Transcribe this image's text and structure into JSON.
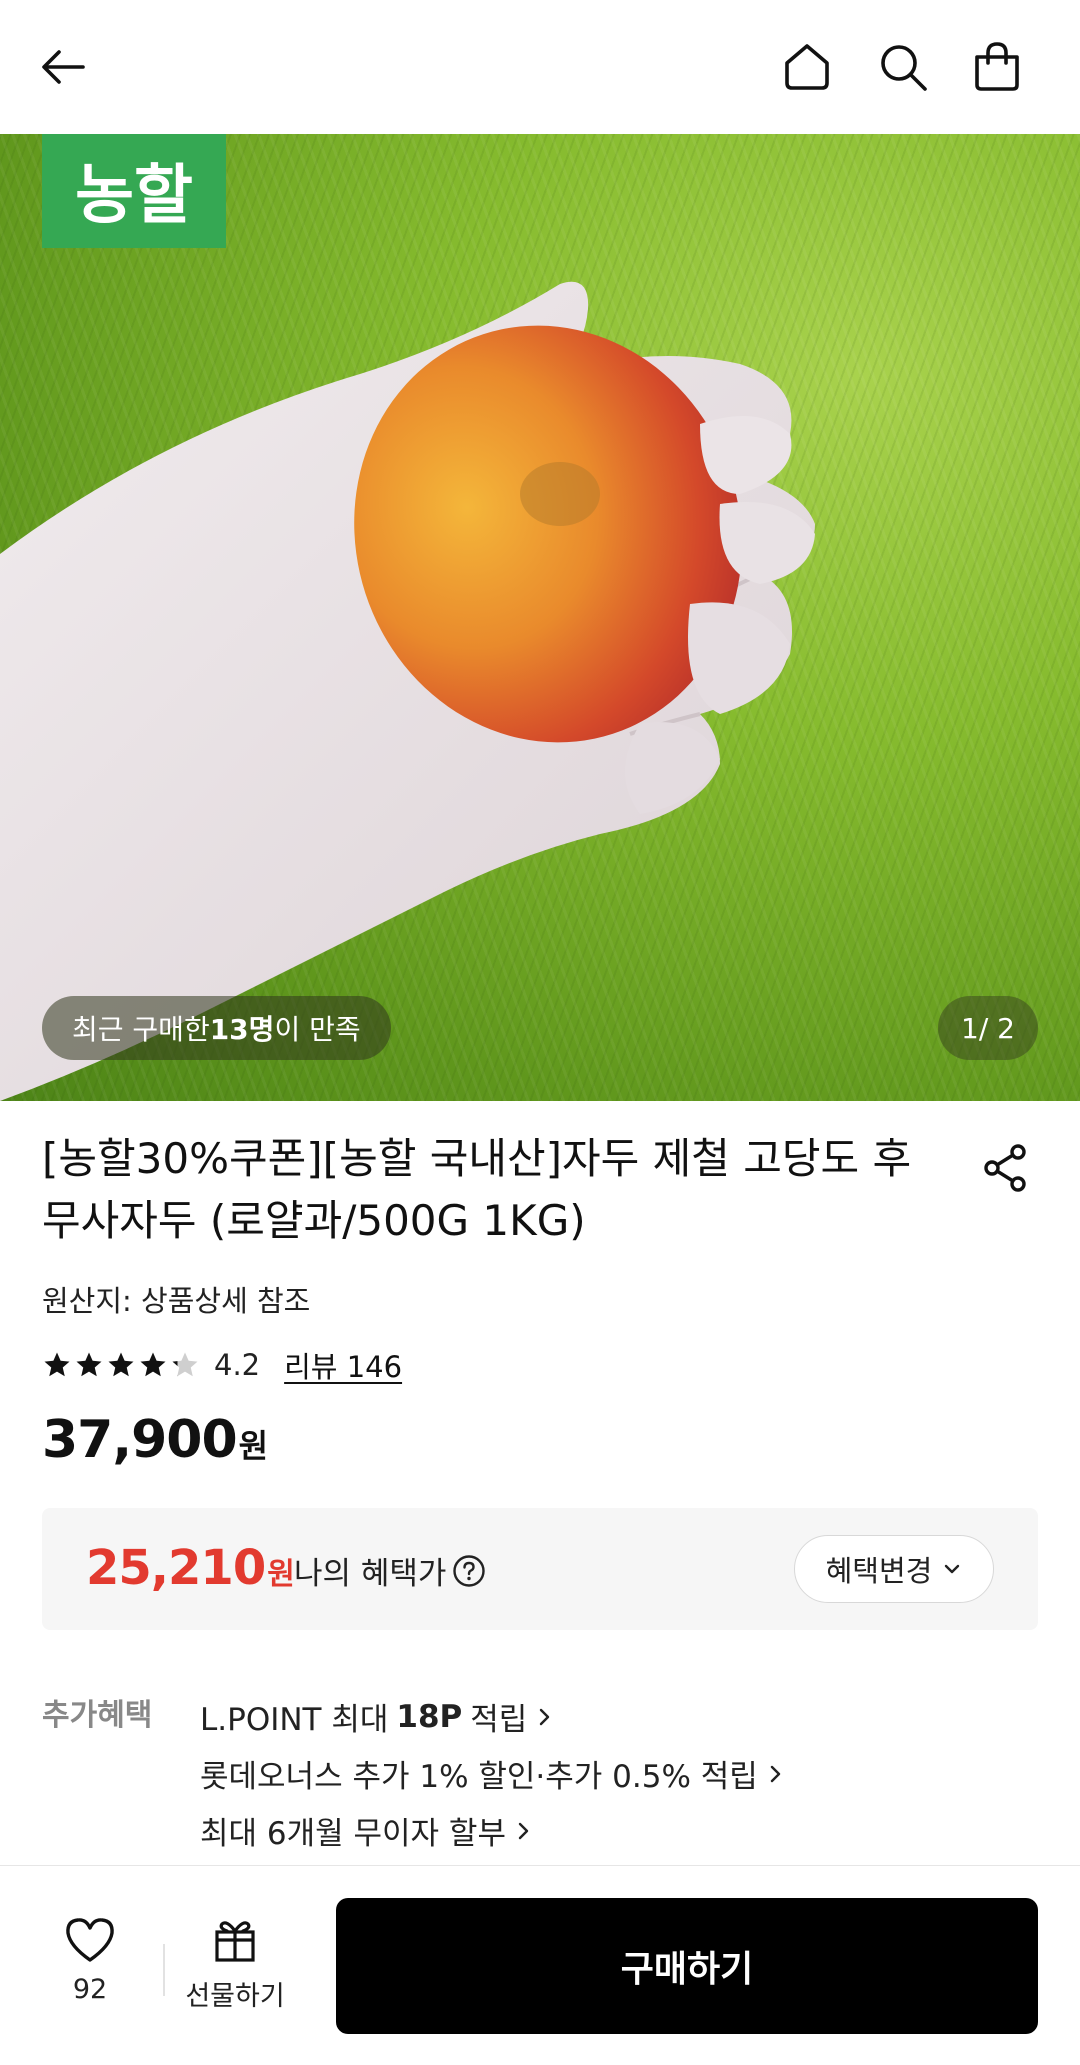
{
  "header": {
    "icons": [
      "back-arrow-icon",
      "home-icon",
      "search-icon",
      "shopping-bag-icon"
    ]
  },
  "hero": {
    "brand_badge": "농할",
    "satisfaction_prefix": "최근 구매한 ",
    "satisfaction_count": "13명",
    "satisfaction_suffix": "이 만족",
    "page_indicator": "1/ 2",
    "current_image": 1,
    "total_images": 2
  },
  "product": {
    "title": "[농할30%쿠폰][농할 국내산]자두 제철 고당도 후무사자두 (로얄과/500G 1KG)",
    "origin": "원산지: 상품상세 참조",
    "rating": "4.2",
    "rating_stars_out_of_5": 4.2,
    "review_link": "리뷰 146",
    "price": "37,900",
    "price_unit": "원"
  },
  "benefit": {
    "price": "25,210",
    "price_unit": "원",
    "label": "나의 혜택가",
    "change_button": "혜택변경"
  },
  "extra_benefits": {
    "label": "추가혜택",
    "items": [
      {
        "before": "L.POINT 최대",
        "bold": "18P",
        "after": "적립"
      },
      {
        "before": "롯데오너스 추가 1% 할인·추가 0.5% 적립",
        "bold": "",
        "after": ""
      },
      {
        "before": "최대 6개월 무이자 할부",
        "bold": "",
        "after": ""
      }
    ]
  },
  "bottom_bar": {
    "like_count": "92",
    "gift_label": "선물하기",
    "buy_label": "구매하기"
  },
  "colors": {
    "accent_red": "#e23a2f",
    "brand_green": "#35a853",
    "buy_button": "#000000"
  }
}
